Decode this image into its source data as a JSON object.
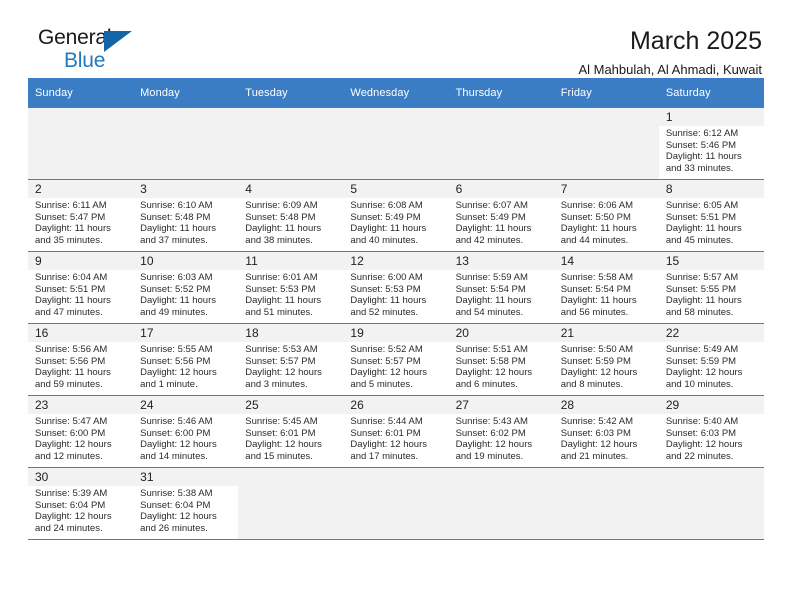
{
  "logo": {
    "name_top": "General",
    "name_bottom": "Blue",
    "triangle_color": "#1465a8",
    "blue_color": "#1f7ac0"
  },
  "header": {
    "title": "March 2025",
    "subtitle": "Al Mahbulah, Al Ahmadi, Kuwait"
  },
  "theme": {
    "header_row_bg": "#3b7dc4",
    "daynum_bg": "#f2f2f2",
    "grid_line": "#4a7ebb"
  },
  "weekdays": [
    "Sunday",
    "Monday",
    "Tuesday",
    "Wednesday",
    "Thursday",
    "Friday",
    "Saturday"
  ],
  "weeks": [
    [
      {
        "day": "",
        "sunrise": "",
        "sunset": "",
        "daylight": "",
        "empty": true
      },
      {
        "day": "",
        "sunrise": "",
        "sunset": "",
        "daylight": "",
        "empty": true
      },
      {
        "day": "",
        "sunrise": "",
        "sunset": "",
        "daylight": "",
        "empty": true
      },
      {
        "day": "",
        "sunrise": "",
        "sunset": "",
        "daylight": "",
        "empty": true
      },
      {
        "day": "",
        "sunrise": "",
        "sunset": "",
        "daylight": "",
        "empty": true
      },
      {
        "day": "",
        "sunrise": "",
        "sunset": "",
        "daylight": "",
        "empty": true
      },
      {
        "day": "1",
        "sunrise": "Sunrise: 6:12 AM",
        "sunset": "Sunset: 5:46 PM",
        "daylight": "Daylight: 11 hours and 33 minutes.",
        "empty": false
      }
    ],
    [
      {
        "day": "2",
        "sunrise": "Sunrise: 6:11 AM",
        "sunset": "Sunset: 5:47 PM",
        "daylight": "Daylight: 11 hours and 35 minutes.",
        "empty": false
      },
      {
        "day": "3",
        "sunrise": "Sunrise: 6:10 AM",
        "sunset": "Sunset: 5:48 PM",
        "daylight": "Daylight: 11 hours and 37 minutes.",
        "empty": false
      },
      {
        "day": "4",
        "sunrise": "Sunrise: 6:09 AM",
        "sunset": "Sunset: 5:48 PM",
        "daylight": "Daylight: 11 hours and 38 minutes.",
        "empty": false
      },
      {
        "day": "5",
        "sunrise": "Sunrise: 6:08 AM",
        "sunset": "Sunset: 5:49 PM",
        "daylight": "Daylight: 11 hours and 40 minutes.",
        "empty": false
      },
      {
        "day": "6",
        "sunrise": "Sunrise: 6:07 AM",
        "sunset": "Sunset: 5:49 PM",
        "daylight": "Daylight: 11 hours and 42 minutes.",
        "empty": false
      },
      {
        "day": "7",
        "sunrise": "Sunrise: 6:06 AM",
        "sunset": "Sunset: 5:50 PM",
        "daylight": "Daylight: 11 hours and 44 minutes.",
        "empty": false
      },
      {
        "day": "8",
        "sunrise": "Sunrise: 6:05 AM",
        "sunset": "Sunset: 5:51 PM",
        "daylight": "Daylight: 11 hours and 45 minutes.",
        "empty": false
      }
    ],
    [
      {
        "day": "9",
        "sunrise": "Sunrise: 6:04 AM",
        "sunset": "Sunset: 5:51 PM",
        "daylight": "Daylight: 11 hours and 47 minutes.",
        "empty": false
      },
      {
        "day": "10",
        "sunrise": "Sunrise: 6:03 AM",
        "sunset": "Sunset: 5:52 PM",
        "daylight": "Daylight: 11 hours and 49 minutes.",
        "empty": false
      },
      {
        "day": "11",
        "sunrise": "Sunrise: 6:01 AM",
        "sunset": "Sunset: 5:53 PM",
        "daylight": "Daylight: 11 hours and 51 minutes.",
        "empty": false
      },
      {
        "day": "12",
        "sunrise": "Sunrise: 6:00 AM",
        "sunset": "Sunset: 5:53 PM",
        "daylight": "Daylight: 11 hours and 52 minutes.",
        "empty": false
      },
      {
        "day": "13",
        "sunrise": "Sunrise: 5:59 AM",
        "sunset": "Sunset: 5:54 PM",
        "daylight": "Daylight: 11 hours and 54 minutes.",
        "empty": false
      },
      {
        "day": "14",
        "sunrise": "Sunrise: 5:58 AM",
        "sunset": "Sunset: 5:54 PM",
        "daylight": "Daylight: 11 hours and 56 minutes.",
        "empty": false
      },
      {
        "day": "15",
        "sunrise": "Sunrise: 5:57 AM",
        "sunset": "Sunset: 5:55 PM",
        "daylight": "Daylight: 11 hours and 58 minutes.",
        "empty": false
      }
    ],
    [
      {
        "day": "16",
        "sunrise": "Sunrise: 5:56 AM",
        "sunset": "Sunset: 5:56 PM",
        "daylight": "Daylight: 11 hours and 59 minutes.",
        "empty": false
      },
      {
        "day": "17",
        "sunrise": "Sunrise: 5:55 AM",
        "sunset": "Sunset: 5:56 PM",
        "daylight": "Daylight: 12 hours and 1 minute.",
        "empty": false
      },
      {
        "day": "18",
        "sunrise": "Sunrise: 5:53 AM",
        "sunset": "Sunset: 5:57 PM",
        "daylight": "Daylight: 12 hours and 3 minutes.",
        "empty": false
      },
      {
        "day": "19",
        "sunrise": "Sunrise: 5:52 AM",
        "sunset": "Sunset: 5:57 PM",
        "daylight": "Daylight: 12 hours and 5 minutes.",
        "empty": false
      },
      {
        "day": "20",
        "sunrise": "Sunrise: 5:51 AM",
        "sunset": "Sunset: 5:58 PM",
        "daylight": "Daylight: 12 hours and 6 minutes.",
        "empty": false
      },
      {
        "day": "21",
        "sunrise": "Sunrise: 5:50 AM",
        "sunset": "Sunset: 5:59 PM",
        "daylight": "Daylight: 12 hours and 8 minutes.",
        "empty": false
      },
      {
        "day": "22",
        "sunrise": "Sunrise: 5:49 AM",
        "sunset": "Sunset: 5:59 PM",
        "daylight": "Daylight: 12 hours and 10 minutes.",
        "empty": false
      }
    ],
    [
      {
        "day": "23",
        "sunrise": "Sunrise: 5:47 AM",
        "sunset": "Sunset: 6:00 PM",
        "daylight": "Daylight: 12 hours and 12 minutes.",
        "empty": false
      },
      {
        "day": "24",
        "sunrise": "Sunrise: 5:46 AM",
        "sunset": "Sunset: 6:00 PM",
        "daylight": "Daylight: 12 hours and 14 minutes.",
        "empty": false
      },
      {
        "day": "25",
        "sunrise": "Sunrise: 5:45 AM",
        "sunset": "Sunset: 6:01 PM",
        "daylight": "Daylight: 12 hours and 15 minutes.",
        "empty": false
      },
      {
        "day": "26",
        "sunrise": "Sunrise: 5:44 AM",
        "sunset": "Sunset: 6:01 PM",
        "daylight": "Daylight: 12 hours and 17 minutes.",
        "empty": false
      },
      {
        "day": "27",
        "sunrise": "Sunrise: 5:43 AM",
        "sunset": "Sunset: 6:02 PM",
        "daylight": "Daylight: 12 hours and 19 minutes.",
        "empty": false
      },
      {
        "day": "28",
        "sunrise": "Sunrise: 5:42 AM",
        "sunset": "Sunset: 6:03 PM",
        "daylight": "Daylight: 12 hours and 21 minutes.",
        "empty": false
      },
      {
        "day": "29",
        "sunrise": "Sunrise: 5:40 AM",
        "sunset": "Sunset: 6:03 PM",
        "daylight": "Daylight: 12 hours and 22 minutes.",
        "empty": false
      }
    ],
    [
      {
        "day": "30",
        "sunrise": "Sunrise: 5:39 AM",
        "sunset": "Sunset: 6:04 PM",
        "daylight": "Daylight: 12 hours and 24 minutes.",
        "empty": false
      },
      {
        "day": "31",
        "sunrise": "Sunrise: 5:38 AM",
        "sunset": "Sunset: 6:04 PM",
        "daylight": "Daylight: 12 hours and 26 minutes.",
        "empty": false
      },
      {
        "day": "",
        "sunrise": "",
        "sunset": "",
        "daylight": "",
        "empty": true
      },
      {
        "day": "",
        "sunrise": "",
        "sunset": "",
        "daylight": "",
        "empty": true
      },
      {
        "day": "",
        "sunrise": "",
        "sunset": "",
        "daylight": "",
        "empty": true
      },
      {
        "day": "",
        "sunrise": "",
        "sunset": "",
        "daylight": "",
        "empty": true
      },
      {
        "day": "",
        "sunrise": "",
        "sunset": "",
        "daylight": "",
        "empty": true
      }
    ]
  ]
}
